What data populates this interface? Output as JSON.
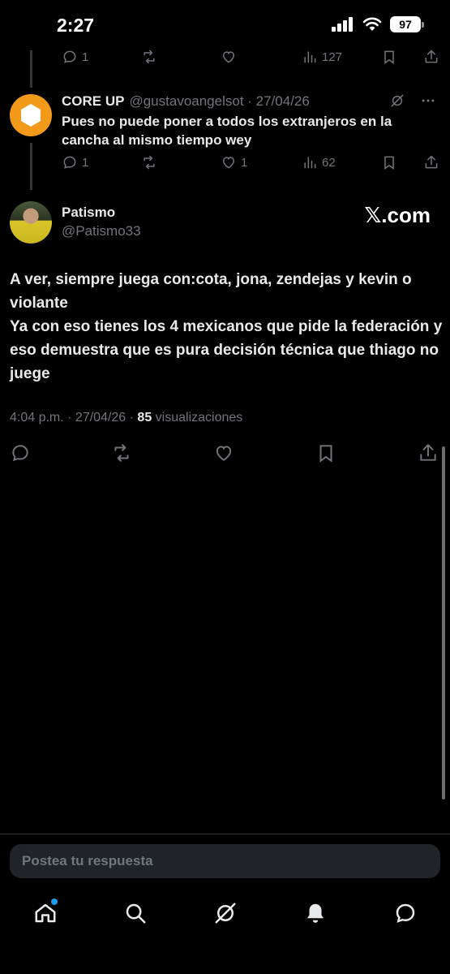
{
  "status_bar": {
    "time": "2:27",
    "battery": "97"
  },
  "top_actions": {
    "replies": "1",
    "retweets": "",
    "likes": "",
    "views": "127"
  },
  "reply_tweet": {
    "name": "CORE UP",
    "handle": "@gustavoangelsot · 27/04/26",
    "text": "Pues no puede poner a todos los extranjeros en la cancha al mismo tiempo wey",
    "replies": "1",
    "likes": "1",
    "views": "62"
  },
  "main_tweet": {
    "name": "Patismo",
    "handle": "@Patismo33",
    "watermark": "𝕏.com",
    "text_line1": "A ver, siempre juega con:cota, jona, zendejas y kevin o violante",
    "text_line2": "Ya con eso tienes los 4 mexicanos que pide la federación y eso demuestra que es pura decisión técnica que thiago no juege",
    "meta_prefix": "4:04 p.m. · 27/04/26 · ",
    "views_count": "85",
    "views_label": " visualizaciones"
  },
  "reply_input": {
    "placeholder": "Postea tu respuesta"
  },
  "icons": {
    "reply": "reply-icon",
    "retweet": "retweet-icon",
    "like": "heart-icon",
    "views": "views-icon",
    "bookmark": "bookmark-icon",
    "share": "share-icon",
    "home": "home-icon",
    "search": "search-icon",
    "grok": "grok-icon",
    "notifications": "bell-icon",
    "messages": "messages-icon"
  },
  "colors": {
    "background": "#000000",
    "text": "#e7e9ea",
    "muted": "#71767b",
    "accent": "#1d9bf0",
    "avatar_coreup": "#f39a1a"
  }
}
